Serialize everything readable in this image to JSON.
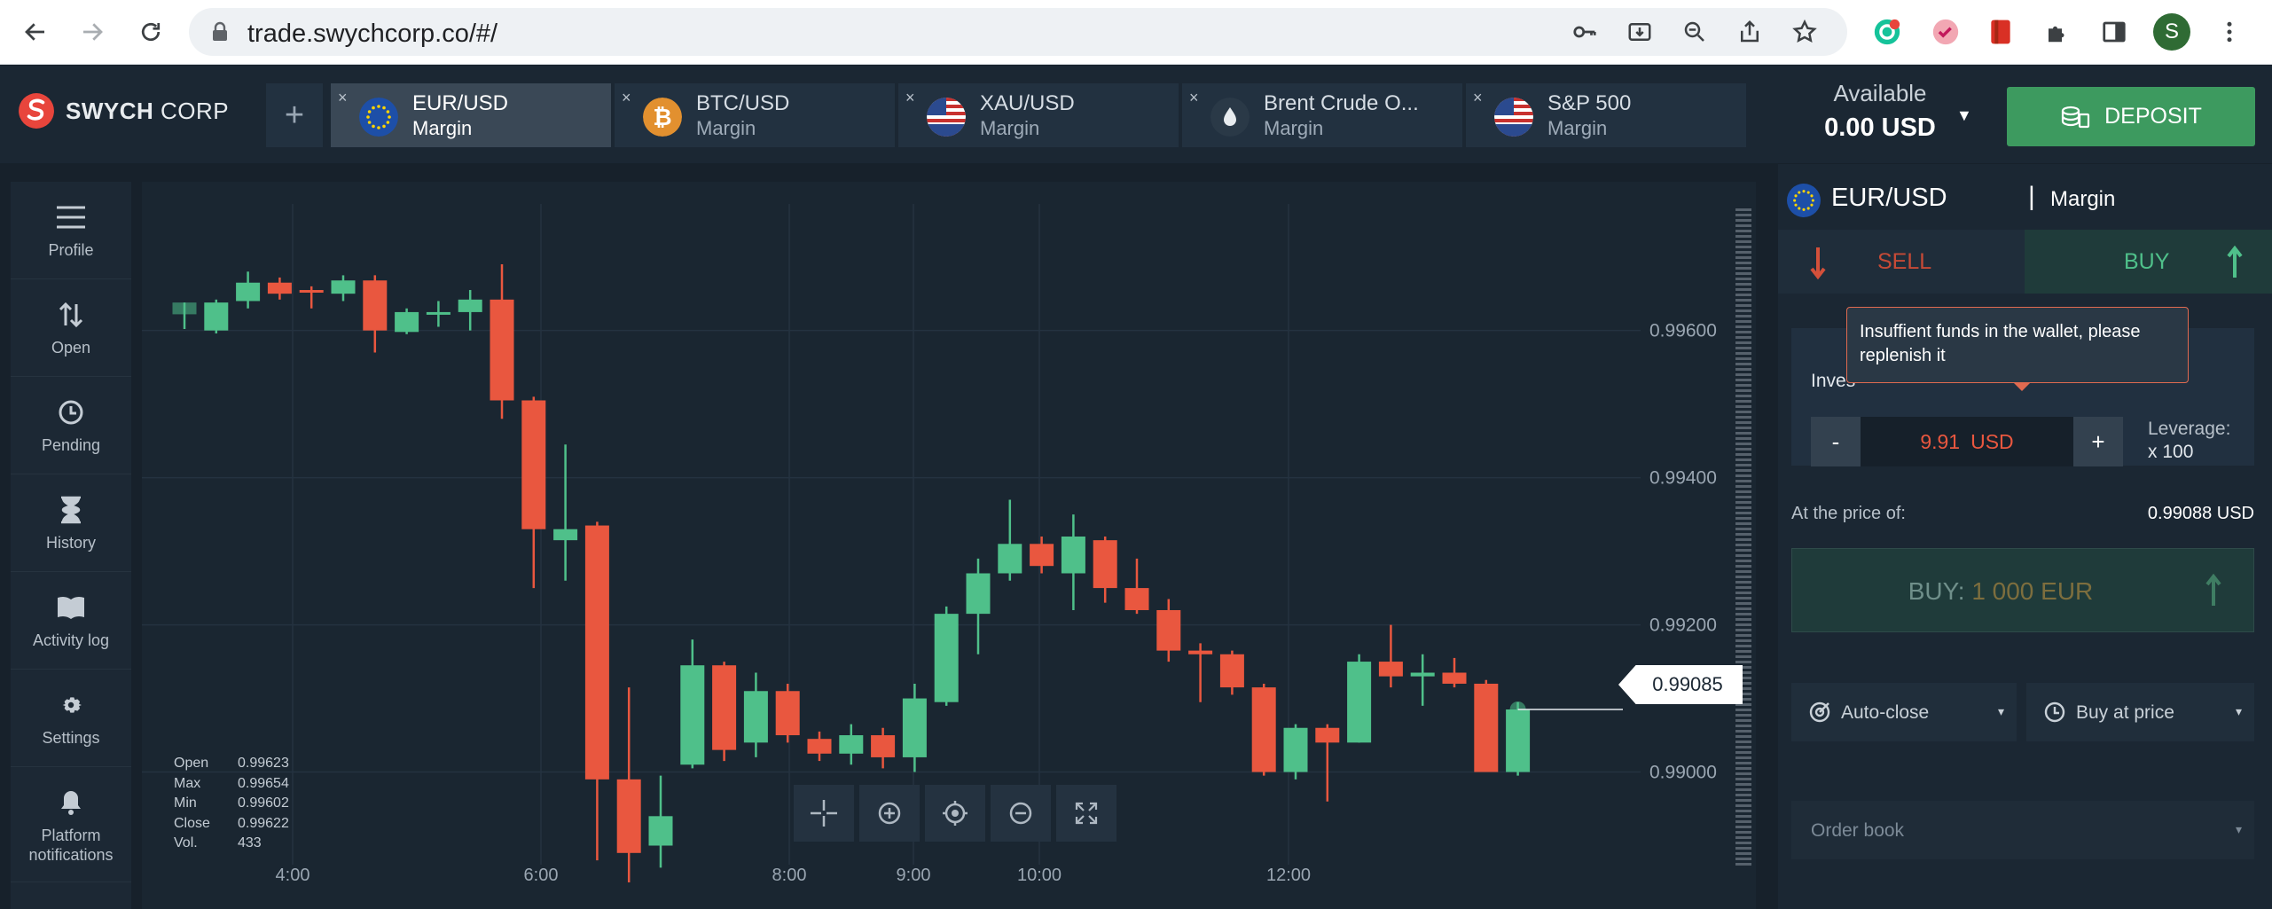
{
  "browser": {
    "url": "trade.swychcorp.co/#/",
    "profile_initial": "S"
  },
  "app": {
    "brand_bold": "SWYCH",
    "brand_light": "CORP",
    "add_tab_label": "+",
    "tabs": [
      {
        "name": "EUR/USD",
        "type": "Margin",
        "icon": "eu-flag-icon",
        "active": true
      },
      {
        "name": "BTC/USD",
        "type": "Margin",
        "icon": "bitcoin-icon",
        "active": false
      },
      {
        "name": "XAU/USD",
        "type": "Margin",
        "icon": "us-flag-icon",
        "active": false
      },
      {
        "name": "Brent Crude O...",
        "type": "Margin",
        "icon": "oil-drop-icon",
        "active": false
      },
      {
        "name": "S&P 500",
        "type": "Margin",
        "icon": "us-flag-icon",
        "active": false
      }
    ],
    "tab_close": "×",
    "balance": {
      "label": "Available",
      "value": "0.00 USD"
    },
    "deposit_label": "DEPOSIT"
  },
  "sidebar": {
    "items": [
      {
        "label": "Profile",
        "icon": "menu-icon"
      },
      {
        "label": "Open",
        "icon": "sort-arrows-icon"
      },
      {
        "label": "Pending",
        "icon": "clock-icon"
      },
      {
        "label": "History",
        "icon": "hourglass-icon"
      },
      {
        "label": "Activity log",
        "icon": "book-icon"
      },
      {
        "label": "Settings",
        "icon": "gear-icon"
      },
      {
        "label": "Platform notifications",
        "icon": "bell-icon"
      }
    ]
  },
  "chart": {
    "ohlc": [
      {
        "label": "Open",
        "value": "0.99623"
      },
      {
        "label": "Max",
        "value": "0.99654"
      },
      {
        "label": "Min",
        "value": "0.99602"
      },
      {
        "label": "Close",
        "value": "0.99622"
      },
      {
        "label": "Vol.",
        "value": "433"
      }
    ],
    "current_price": "0.99085",
    "colors": {
      "up": "#4fc08a",
      "down": "#e9573f",
      "grid": "#243240",
      "text": "#9aa6b2"
    }
  },
  "chart_data": {
    "type": "candlestick",
    "x_ticks": [
      "4:00",
      "6:00",
      "8:00",
      "9:00",
      "10:00",
      "12:00"
    ],
    "y_ticks": [
      "0.99600",
      "0.99400",
      "0.99200",
      "0.99000"
    ],
    "y_tick_values": [
      0.996,
      0.994,
      0.992,
      0.99
    ],
    "ylim": [
      0.9885,
      0.9979
    ],
    "candles": [
      {
        "o": 0.99622,
        "h": 0.99638,
        "l": 0.99602,
        "c": 0.99638
      },
      {
        "o": 0.996,
        "h": 0.99642,
        "l": 0.99596,
        "c": 0.99638
      },
      {
        "o": 0.9964,
        "h": 0.9968,
        "l": 0.9963,
        "c": 0.99665
      },
      {
        "o": 0.99665,
        "h": 0.99672,
        "l": 0.99642,
        "c": 0.9965
      },
      {
        "o": 0.99655,
        "h": 0.9966,
        "l": 0.9963,
        "c": 0.99652
      },
      {
        "o": 0.9965,
        "h": 0.99675,
        "l": 0.9964,
        "c": 0.99668
      },
      {
        "o": 0.99668,
        "h": 0.99675,
        "l": 0.9957,
        "c": 0.996
      },
      {
        "o": 0.99598,
        "h": 0.9963,
        "l": 0.99595,
        "c": 0.99625
      },
      {
        "o": 0.99625,
        "h": 0.9964,
        "l": 0.99605,
        "c": 0.99625
      },
      {
        "o": 0.99625,
        "h": 0.99655,
        "l": 0.996,
        "c": 0.99642
      },
      {
        "o": 0.99642,
        "h": 0.9969,
        "l": 0.9948,
        "c": 0.99505
      },
      {
        "o": 0.99505,
        "h": 0.9951,
        "l": 0.9925,
        "c": 0.9933
      },
      {
        "o": 0.99315,
        "h": 0.99445,
        "l": 0.9926,
        "c": 0.9933
      },
      {
        "o": 0.99335,
        "h": 0.9934,
        "l": 0.9888,
        "c": 0.9899
      },
      {
        "o": 0.9899,
        "h": 0.99115,
        "l": 0.9885,
        "c": 0.9889
      },
      {
        "o": 0.989,
        "h": 0.98995,
        "l": 0.9887,
        "c": 0.9894
      },
      {
        "o": 0.9901,
        "h": 0.9918,
        "l": 0.99005,
        "c": 0.99145
      },
      {
        "o": 0.99145,
        "h": 0.9915,
        "l": 0.99015,
        "c": 0.9903
      },
      {
        "o": 0.9904,
        "h": 0.99135,
        "l": 0.9902,
        "c": 0.9911
      },
      {
        "o": 0.9911,
        "h": 0.9912,
        "l": 0.9904,
        "c": 0.9905
      },
      {
        "o": 0.99045,
        "h": 0.99055,
        "l": 0.99015,
        "c": 0.99025
      },
      {
        "o": 0.99025,
        "h": 0.99065,
        "l": 0.9901,
        "c": 0.9905
      },
      {
        "o": 0.9905,
        "h": 0.9906,
        "l": 0.99005,
        "c": 0.9902
      },
      {
        "o": 0.9902,
        "h": 0.9912,
        "l": 0.99,
        "c": 0.991
      },
      {
        "o": 0.99095,
        "h": 0.99225,
        "l": 0.9909,
        "c": 0.99215
      },
      {
        "o": 0.99215,
        "h": 0.9929,
        "l": 0.9916,
        "c": 0.9927
      },
      {
        "o": 0.9927,
        "h": 0.9937,
        "l": 0.9926,
        "c": 0.9931
      },
      {
        "o": 0.9931,
        "h": 0.9932,
        "l": 0.9927,
        "c": 0.9928
      },
      {
        "o": 0.9927,
        "h": 0.9935,
        "l": 0.9922,
        "c": 0.9932
      },
      {
        "o": 0.99315,
        "h": 0.9932,
        "l": 0.9923,
        "c": 0.9925
      },
      {
        "o": 0.9925,
        "h": 0.9929,
        "l": 0.99215,
        "c": 0.9922
      },
      {
        "o": 0.9922,
        "h": 0.99235,
        "l": 0.9915,
        "c": 0.99165
      },
      {
        "o": 0.99165,
        "h": 0.99175,
        "l": 0.99095,
        "c": 0.9916
      },
      {
        "o": 0.9916,
        "h": 0.99165,
        "l": 0.99105,
        "c": 0.99115
      },
      {
        "o": 0.99115,
        "h": 0.9912,
        "l": 0.98995,
        "c": 0.99
      },
      {
        "o": 0.99,
        "h": 0.99065,
        "l": 0.9899,
        "c": 0.9906
      },
      {
        "o": 0.9906,
        "h": 0.99065,
        "l": 0.9896,
        "c": 0.9904
      },
      {
        "o": 0.9904,
        "h": 0.9916,
        "l": 0.9904,
        "c": 0.9915
      },
      {
        "o": 0.9915,
        "h": 0.992,
        "l": 0.99115,
        "c": 0.9913
      },
      {
        "o": 0.9913,
        "h": 0.9916,
        "l": 0.9909,
        "c": 0.99135
      },
      {
        "o": 0.99135,
        "h": 0.99155,
        "l": 0.99115,
        "c": 0.9912
      },
      {
        "o": 0.9912,
        "h": 0.99125,
        "l": 0.99,
        "c": 0.99
      },
      {
        "o": 0.99,
        "h": 0.99095,
        "l": 0.98995,
        "c": 0.99085
      }
    ]
  },
  "order": {
    "pair": "EUR/USD",
    "separator": "|",
    "type": "Margin",
    "sell_label": "SELL",
    "buy_label": "BUY",
    "investment_label": "Inves",
    "tooltip": "Insuffient funds in the wallet, please replenish it",
    "minus": "-",
    "plus": "+",
    "amount": "9.91",
    "currency": "USD",
    "leverage_label": "Leverage:",
    "leverage_value": "x 100",
    "at_price_label": "At the price of:",
    "at_price_value": "0.99088 USD",
    "buy_action_prefix": "BUY:",
    "buy_action_amount": "1 000 EUR",
    "auto_close_label": "Auto-close",
    "buy_at_price_label": "Buy at price",
    "order_book_label": "Order book",
    "caret": "▾"
  }
}
